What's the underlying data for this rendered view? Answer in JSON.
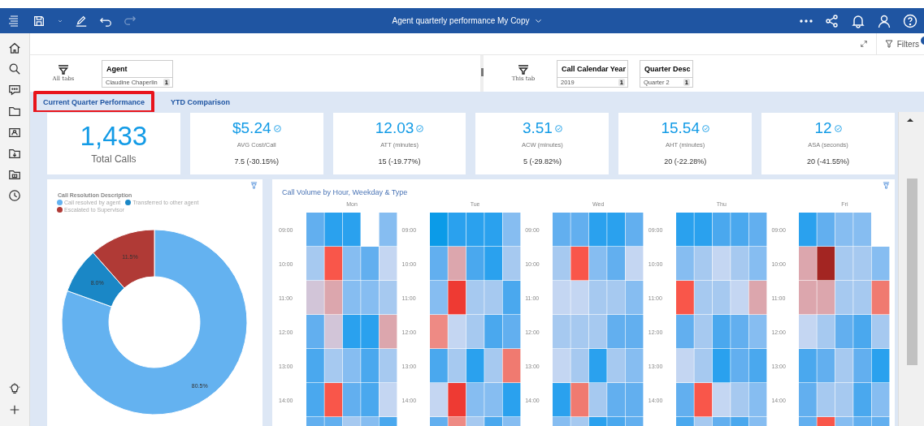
{
  "app_bar": {
    "title": "Agent quarterly performance My Copy"
  },
  "toolbar": {
    "filters_label": "Filters"
  },
  "filter_bar": {
    "all_tabs_label": "All tabs",
    "all_tabs_filters": [
      {
        "title": "Agent",
        "value": "Claudine Chaperlin",
        "count": "1"
      }
    ],
    "this_tab_label": "This tab",
    "this_tab_filters": [
      {
        "title": "Call Calendar Year",
        "value": "2019",
        "count": "1"
      },
      {
        "title": "Quarter Desc",
        "value": "Quarter 2",
        "count": "1"
      }
    ]
  },
  "tabs": [
    {
      "label": "Current Quarter Performance",
      "selected": true
    },
    {
      "label": "YTD Comparison",
      "selected": false
    }
  ],
  "kpis": [
    {
      "kind": "total",
      "value": "1,433",
      "label": "Total Calls"
    },
    {
      "kind": "target",
      "value": "$5.24",
      "label": "AVG Cost/Call",
      "comparison": "7.5 (-30.15%)"
    },
    {
      "kind": "target",
      "value": "12.03",
      "label": "ATT (minutes)",
      "comparison": "15 (-19.77%)"
    },
    {
      "kind": "target",
      "value": "3.51",
      "label": "ACW (minutes)",
      "comparison": "5 (-29.82%)"
    },
    {
      "kind": "target",
      "value": "15.54",
      "label": "AHT (minutes)",
      "comparison": "20 (-22.28%)"
    },
    {
      "kind": "target",
      "value": "12",
      "label": "ASA (seconds)",
      "comparison": "20 (-41.55%)"
    }
  ],
  "resolution_chart": {
    "legend_title": "Call Resolution Description",
    "legend": [
      {
        "color": "#64b2f0"
      },
      {
        "color": "#1a87c6"
      },
      {
        "color": "#b03a36"
      }
    ],
    "chart_data": {
      "type": "donut",
      "categories": [
        "Call resolved by agent",
        "Transferred to other agent",
        "Escalated to Supervisor"
      ],
      "values": [
        80.5,
        8.0,
        11.5
      ],
      "value_labels": [
        "80.5%",
        "8.0%",
        "11.5%"
      ]
    }
  },
  "heatmap": {
    "title": "Call Volume by Hour, Weekday & Type",
    "days": [
      {
        "name": "Mon",
        "hours": [
          "09:00",
          "10:00",
          "11:00",
          "12:00",
          "13:00",
          "14:00"
        ]
      },
      {
        "name": "Tue",
        "hours": [
          "09:00",
          "10:00",
          "11:00",
          "12:00",
          "13:00",
          "14:00"
        ]
      },
      {
        "name": "Wed",
        "hours": [
          "09:00",
          "10:00",
          "11:00",
          "12:00",
          "13:00",
          "14:00"
        ]
      },
      {
        "name": "Thu",
        "hours": [
          "09:00",
          "10:00",
          "11:00",
          "12:00",
          "13:00",
          "14:00"
        ]
      },
      {
        "name": "Fri",
        "hours": [
          "09:00",
          "10:00",
          "11:00",
          "12:00",
          "13:00",
          "14:00"
        ]
      }
    ]
  }
}
